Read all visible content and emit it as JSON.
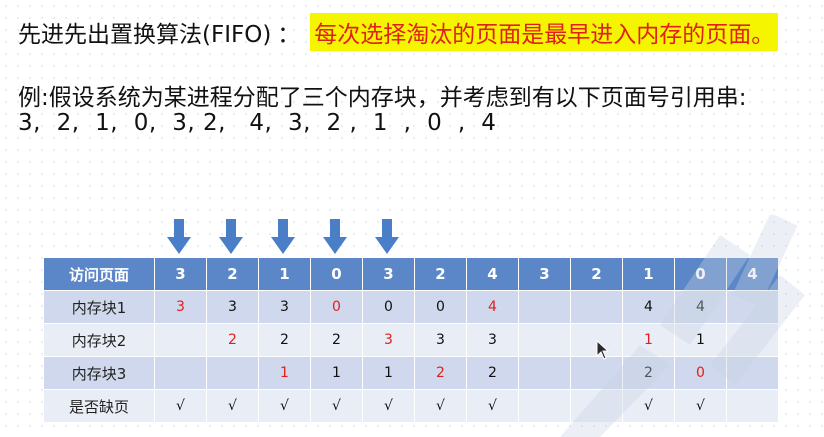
{
  "title": {
    "left": "先进先出置换算法(FIFO)",
    "colon": "：",
    "highlight": "每次选择淘汰的页面是最早进入内存的页面。"
  },
  "example": {
    "text": "例:假设系统为某进程分配了三个内存块，并考虑到有以下页面号引用串:",
    "sequence": "3,  2,  1,  0,  3, 2,   4,  3,  2 ,  1  ,  0  ,  4"
  },
  "colors": {
    "header_bg": "#5b87c8",
    "row_odd": "#cfd8ec",
    "row_even": "#e9edf6",
    "highlight": "#f5f500",
    "red": "#e21e1e",
    "arrow": "#4a7fc8"
  },
  "arrow_columns": [
    0,
    1,
    2,
    3,
    4
  ],
  "table": {
    "header_label": "访问页面",
    "pages": [
      "3",
      "2",
      "1",
      "0",
      "3",
      "2",
      "4",
      "3",
      "2",
      "1",
      "0",
      "4"
    ],
    "rows": [
      {
        "label": "内存块1",
        "cells": [
          {
            "v": "3",
            "red": true
          },
          {
            "v": "3"
          },
          {
            "v": "3"
          },
          {
            "v": "0",
            "red": true
          },
          {
            "v": "0"
          },
          {
            "v": "0"
          },
          {
            "v": "4",
            "red": true
          },
          {
            "v": ""
          },
          {
            "v": ""
          },
          {
            "v": "4"
          },
          {
            "v": "4"
          },
          {
            "v": ""
          }
        ]
      },
      {
        "label": "内存块2",
        "cells": [
          {
            "v": ""
          },
          {
            "v": "2",
            "red": true
          },
          {
            "v": "2"
          },
          {
            "v": "2"
          },
          {
            "v": "3",
            "red": true
          },
          {
            "v": "3"
          },
          {
            "v": "3"
          },
          {
            "v": ""
          },
          {
            "v": ""
          },
          {
            "v": "1",
            "red": true
          },
          {
            "v": "1"
          },
          {
            "v": ""
          }
        ]
      },
      {
        "label": "内存块3",
        "cells": [
          {
            "v": ""
          },
          {
            "v": ""
          },
          {
            "v": "1",
            "red": true
          },
          {
            "v": "1"
          },
          {
            "v": "1"
          },
          {
            "v": "2",
            "red": true
          },
          {
            "v": "2"
          },
          {
            "v": ""
          },
          {
            "v": ""
          },
          {
            "v": "2"
          },
          {
            "v": "0",
            "red": true
          },
          {
            "v": ""
          }
        ]
      },
      {
        "label": "是否缺页",
        "cells": [
          {
            "v": "√"
          },
          {
            "v": "√"
          },
          {
            "v": "√"
          },
          {
            "v": "√"
          },
          {
            "v": "√"
          },
          {
            "v": "√"
          },
          {
            "v": "√"
          },
          {
            "v": ""
          },
          {
            "v": ""
          },
          {
            "v": "√"
          },
          {
            "v": "√"
          },
          {
            "v": ""
          }
        ]
      }
    ]
  }
}
